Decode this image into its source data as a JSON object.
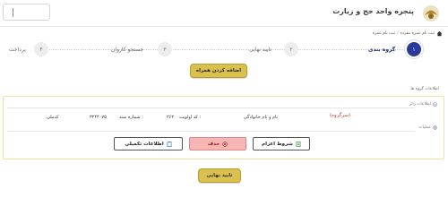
{
  "header": {
    "title": "پنجره واحد حج و زیارت",
    "user_box_value": ""
  },
  "breadcrumb": {
    "items": [
      "ثبت نام عمره",
      "ثبت نام عمره مفرده"
    ]
  },
  "steps": [
    {
      "number": "۱",
      "label": "گروه بندی",
      "active": true
    },
    {
      "number": "۲",
      "label": "تایید نهایی",
      "active": false
    },
    {
      "number": "۳",
      "label": "جستجو کاروان",
      "active": false
    },
    {
      "number": "۴",
      "label": "پرداخت",
      "active": false
    }
  ],
  "add_companion_button": "اضافه کردن همراه",
  "group_section_title": "اطلاعات گروه ها",
  "pilgrim": {
    "info_label": "اطلاعات زائر",
    "operations_label": "عملیات",
    "role": "(سرگروه)",
    "name_label": "نام و نام خانوادگی",
    "priority_label": "کد اولویت :",
    "priority_value": "۲۶۲",
    "doc_label": "شماره سند :",
    "doc_value": "۳۲۴۴۰۷۵",
    "national_label": "کدملی"
  },
  "actions": {
    "terms_button": "شروط اعزام",
    "delete_button": "حذف",
    "more_info_button": "اطلاعات تکمیلی"
  },
  "confirm_button": "تایید نهایی",
  "colors": {
    "accent": "#2b3a9a",
    "gold": "#d9c04f",
    "delete": "#f6b6b6",
    "card_border": "#efe3a3"
  }
}
